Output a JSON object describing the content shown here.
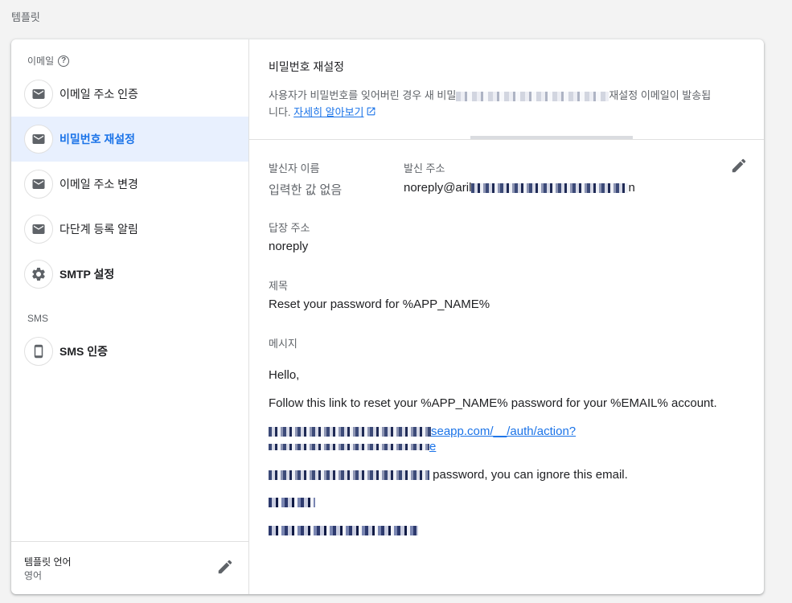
{
  "page": {
    "title": "템플릿"
  },
  "sidebar": {
    "email_section_label": "이메일",
    "sms_section_label": "SMS",
    "items": [
      {
        "label": "이메일 주소 인증",
        "icon": "mail-icon"
      },
      {
        "label": "비밀번호 재설정",
        "icon": "mail-icon",
        "active": true
      },
      {
        "label": "이메일 주소 변경",
        "icon": "mail-icon"
      },
      {
        "label": "다단계 등록 알림",
        "icon": "mail-icon"
      },
      {
        "label": "SMTP 설정",
        "icon": "gear-icon"
      },
      {
        "label": "SMS 인증",
        "icon": "phone-icon"
      }
    ],
    "footer": {
      "label": "템플릿 언어",
      "value": "영어"
    }
  },
  "main": {
    "title": "비밀번호 재설정",
    "desc_prefix": "사용자가 비밀번호를 잊어버린 경우 새 비밀",
    "desc_suffix": "재설정 이메일이 발송됩",
    "desc_line2": "니다.",
    "learn_more": "자세히 알아보기",
    "sender_name_label": "발신자 이름",
    "sender_name_value": "입력한 값 없음",
    "sender_addr_label": "발신 주소",
    "sender_addr_prefix": "noreply@aril",
    "sender_addr_suffix": "n",
    "reply_label": "답장 주소",
    "reply_value": "noreply",
    "subject_label": "제목",
    "subject_value": "Reset your password for %APP_NAME%",
    "message_label": "메시지",
    "msg_hello": "Hello,",
    "msg_follow": "Follow this link to reset your %APP_NAME% password for your %EMAIL% account.",
    "msg_link_1": "seapp.com/__/auth/action?",
    "msg_link_2": "e",
    "msg_ignore": "password, you can ignore this email."
  },
  "colors": {
    "accent": "#1a73e8",
    "active_bg": "#e8f0fe"
  }
}
